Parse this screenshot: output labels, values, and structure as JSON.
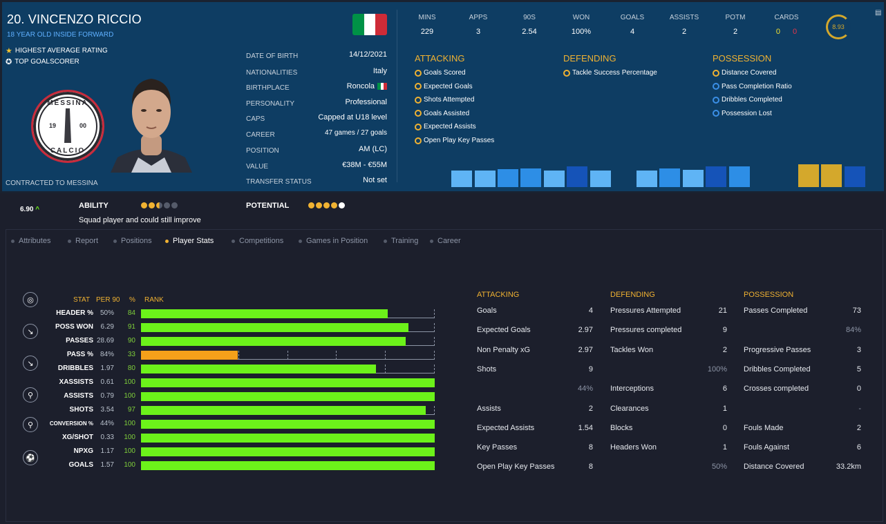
{
  "player": {
    "name": "20. VINCENZO RICCIO",
    "role": "18 YEAR OLD INSIDE FORWARD",
    "accolades": [
      "HIGHEST AVERAGE RATING",
      "TOP GOALSCORER"
    ],
    "contract": "CONTRACTED TO MESSINA",
    "badge": {
      "top": "MESSINA",
      "bottom": "CALCIO",
      "year_left": "19",
      "year_right": "00"
    }
  },
  "info": [
    {
      "label": "DATE OF BIRTH",
      "value": "14/12/2021"
    },
    {
      "label": "NATIONALITIES",
      "value": "Italy"
    },
    {
      "label": "BIRTHPLACE",
      "value": "Roncola"
    },
    {
      "label": "PERSONALITY",
      "value": "Professional"
    },
    {
      "label": "CAPS",
      "value": "Capped at U18 level"
    },
    {
      "label": "CAREER",
      "value": "47  games /  27  goals"
    },
    {
      "label": "POSITION",
      "value": "AM (LC)"
    },
    {
      "label": "VALUE",
      "value": "€38M - €55M"
    },
    {
      "label": "TRANSFER STATUS",
      "value": "Not set"
    }
  ],
  "flag_colors": [
    "#009246",
    "#ffffff",
    "#ce2b37"
  ],
  "top_stats": [
    {
      "label": "MINS",
      "value": "229"
    },
    {
      "label": "APPS",
      "value": "3"
    },
    {
      "label": "90S",
      "value": "2.54"
    },
    {
      "label": "WON",
      "value": "100%"
    },
    {
      "label": "GOALS",
      "value": "4"
    },
    {
      "label": "ASSISTS",
      "value": "2"
    },
    {
      "label": "POTM",
      "value": "2"
    },
    {
      "label": "CARDS",
      "yellow": "0",
      "red": "0"
    }
  ],
  "avg_rating": "8.93",
  "more_icon": "clipboard-icon",
  "profile": {
    "attacking": {
      "title": "ATTACKING",
      "items": [
        "Goals Scored",
        "Expected Goals",
        "Shots Attempted",
        "Goals Assisted",
        "Expected Assists",
        "Open Play Key Passes"
      ]
    },
    "defending": {
      "title": "DEFENDING",
      "items": [
        "Tackle Success Percentage"
      ]
    },
    "possession": {
      "title": "POSSESSION",
      "items": [
        "Distance Covered",
        "Pass Completion Ratio",
        "Dribbles Completed",
        "Possession Lost"
      ],
      "item_colors": [
        "gold",
        "blue",
        "blue",
        "blue"
      ]
    },
    "bars": [
      {
        "color": "#5fb4f5",
        "level": 0.72
      },
      {
        "color": "#5fb4f5",
        "level": 0.72
      },
      {
        "color": "#2d8ee6",
        "level": 0.8
      },
      {
        "color": "#2d8ee6",
        "level": 0.83
      },
      {
        "color": "#5fb4f5",
        "level": 0.72
      },
      {
        "color": "#1553b8",
        "level": 0.92
      },
      {
        "color": "#5fb4f5",
        "level": 0.72
      },
      {
        "color": "#5fb4f5",
        "level": 0.72
      },
      {
        "color": "#2d8ee6",
        "level": 0.83
      },
      {
        "color": "#5fb4f5",
        "level": 0.76
      },
      {
        "color": "#1553b8",
        "level": 0.92
      },
      {
        "color": "#2d8ee6",
        "level": 0.92
      },
      {
        "color": "#d4a82c",
        "level": 1.0
      },
      {
        "color": "#d4a82c",
        "level": 1.0
      },
      {
        "color": "#1553b8",
        "level": 0.92
      }
    ]
  },
  "ability": {
    "score": "6.90",
    "trend": "^",
    "label": "ABILITY",
    "stars": 2.5,
    "desc": "Squad player and could still improve",
    "potential_label": "POTENTIAL",
    "potential_stars": 5
  },
  "tabs": [
    {
      "label": "Attributes",
      "active": false
    },
    {
      "label": "Report",
      "active": false
    },
    {
      "label": "Positions",
      "active": false
    },
    {
      "label": "Player Stats",
      "active": true
    },
    {
      "label": "Competitions",
      "active": false
    },
    {
      "label": "Games in Position",
      "active": false
    },
    {
      "label": "Training",
      "active": false
    },
    {
      "label": "Career",
      "active": false
    }
  ],
  "chart_data": {
    "type": "bar",
    "headers": {
      "stat": "STAT",
      "per90": "PER 90",
      "pct": "%",
      "rank": "RANK"
    },
    "categories": [
      "HEADER %",
      "POSS WON",
      "PASSES",
      "PASS %",
      "DRIBBLES",
      "XASSISTS",
      "ASSISTS",
      "SHOTS",
      "CONVERSION %",
      "XG/SHOT",
      "NPXG",
      "GOALS"
    ],
    "per90": [
      "50%",
      "6.29",
      "28.69",
      "84%",
      "1.97",
      "0.61",
      "0.79",
      "3.54",
      "44%",
      "0.33",
      "1.17",
      "1.57"
    ],
    "values": [
      84,
      91,
      90,
      33,
      80,
      100,
      100,
      97,
      100,
      100,
      100,
      100
    ],
    "bar_colors": [
      "#6cf21a",
      "#6cf21a",
      "#6cf21a",
      "#f5a01a",
      "#6cf21a",
      "#6cf21a",
      "#6cf21a",
      "#6cf21a",
      "#6cf21a",
      "#6cf21a",
      "#6cf21a",
      "#6cf21a"
    ],
    "ylim": [
      0,
      100
    ]
  },
  "side_icons": [
    "target-icon",
    "tackle-icon",
    "tackle-icon",
    "running-icon",
    "running-icon",
    "shooting-icon"
  ],
  "tables": {
    "attacking": {
      "title": "ATTACKING",
      "rows": [
        {
          "label": "Goals",
          "value": "4"
        },
        {
          "label": "Expected Goals",
          "value": "2.97"
        },
        {
          "label": "Non Penalty xG",
          "value": "2.97"
        },
        {
          "label": "Shots",
          "value": "9"
        },
        {
          "label": "",
          "value": "44%",
          "dim": true
        },
        {
          "label": "Assists",
          "value": "2"
        },
        {
          "label": "Expected Assists",
          "value": "1.54"
        },
        {
          "label": "Key Passes",
          "value": "8"
        },
        {
          "label": "Open Play Key Passes",
          "value": "8"
        }
      ]
    },
    "defending": {
      "title": "DEFENDING",
      "rows": [
        {
          "label": "Pressures Attempted",
          "value": "21"
        },
        {
          "label": "Pressures completed",
          "value": "9"
        },
        {
          "label": "Tackles Won",
          "value": "2"
        },
        {
          "label": "",
          "value": "100%",
          "dim": true
        },
        {
          "label": "Interceptions",
          "value": "6"
        },
        {
          "label": "Clearances",
          "value": "1"
        },
        {
          "label": "Blocks",
          "value": "0"
        },
        {
          "label": "Headers Won",
          "value": "1"
        },
        {
          "label": "",
          "value": "50%",
          "dim": true
        }
      ]
    },
    "possession": {
      "title": "POSSESSION",
      "rows": [
        {
          "label": "Passes Completed",
          "value": "73"
        },
        {
          "label": "",
          "value": "84%",
          "dim": true
        },
        {
          "label": "Progressive Passes",
          "value": "3"
        },
        {
          "label": "Dribbles Completed",
          "value": "5"
        },
        {
          "label": "Crosses completed",
          "value": "0"
        },
        {
          "label": "",
          "value": "-",
          "dim": true
        },
        {
          "label": "Fouls Made",
          "value": "2"
        },
        {
          "label": "Fouls Against",
          "value": "6"
        },
        {
          "label": "Distance Covered",
          "value": "33.2km"
        }
      ]
    }
  }
}
